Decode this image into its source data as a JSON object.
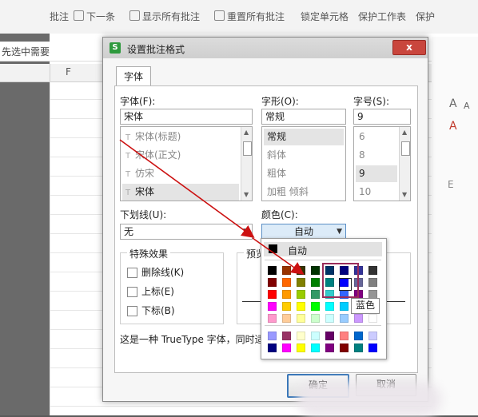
{
  "toolbar": {
    "items": [
      {
        "label": "批注"
      },
      {
        "label": "下一条"
      },
      {
        "label": "显示所有批注"
      },
      {
        "label": "重置所有批注"
      },
      {
        "label": "锁定单元格"
      },
      {
        "label": "保护工作表"
      },
      {
        "label": "保护"
      }
    ]
  },
  "sheet": {
    "side_text": "先选中需要",
    "column_header": "F",
    "right_glyphs": [
      "A",
      "A",
      "A",
      "E"
    ]
  },
  "dialog": {
    "title": "设置批注格式",
    "close_label": "x",
    "tab_label": "字体",
    "font_label": "字体(F):",
    "font_value": "宋体",
    "font_list": [
      "宋体(标题)",
      "宋体(正文)",
      "仿宋",
      "宋体"
    ],
    "style_label": "字形(O):",
    "style_value": "常规",
    "style_list": [
      "常规",
      "斜体",
      "粗体",
      "加粗 倾斜"
    ],
    "size_label": "字号(S):",
    "size_value": "9",
    "size_list": [
      "6",
      "8",
      "9",
      "10"
    ],
    "underline_label": "下划线(U):",
    "underline_value": "无",
    "color_label": "颜色(C):",
    "color_value": "自动",
    "effects_title": "特殊效果",
    "effects": [
      "删除线(K)",
      "上标(E)",
      "下标(B)"
    ],
    "preview_title": "预览",
    "info_text": "这是一种 TrueType 字体，同时适",
    "ok_label": "确定",
    "cancel_label": "取消"
  },
  "color_popup": {
    "auto_label": "自动",
    "tooltip": "蓝色",
    "palette_rows": [
      [
        "#000000",
        "#993300",
        "#333300",
        "#003300",
        "#003366",
        "#000080",
        "#333399",
        "#333333"
      ],
      [
        "#800000",
        "#FF6600",
        "#808000",
        "#008000",
        "#008080",
        "#0000FF",
        "#666699",
        "#808080"
      ],
      [
        "#FF0000",
        "#FF9900",
        "#99CC00",
        "#339966",
        "#33CCCC",
        "#3366FF",
        "#800080",
        "#969696"
      ],
      [
        "#FF00FF",
        "#FFCC00",
        "#FFFF00",
        "#00FF00",
        "#00FFFF",
        "#00CCFF",
        "#993366",
        "#C0C0C0"
      ],
      [
        "#FF99CC",
        "#FFCC99",
        "#FFFF99",
        "#CCFFCC",
        "#CCFFFF",
        "#99CCFF",
        "#CC99FF",
        "#FFFFFF"
      ]
    ],
    "extra_rows": [
      [
        "#9999FF",
        "#993366",
        "#FFFFCC",
        "#CCFFFF",
        "#660066",
        "#FF8080",
        "#0066CC",
        "#CCCCFF"
      ],
      [
        "#000080",
        "#FF00FF",
        "#FFFF00",
        "#00FFFF",
        "#800080",
        "#800000",
        "#008080",
        "#0000FF"
      ]
    ]
  },
  "colors": {
    "accent": "#3a77b8",
    "highlight_border": "#9b2d5b",
    "arrow": "#cc1111",
    "close": "#c9463d"
  }
}
